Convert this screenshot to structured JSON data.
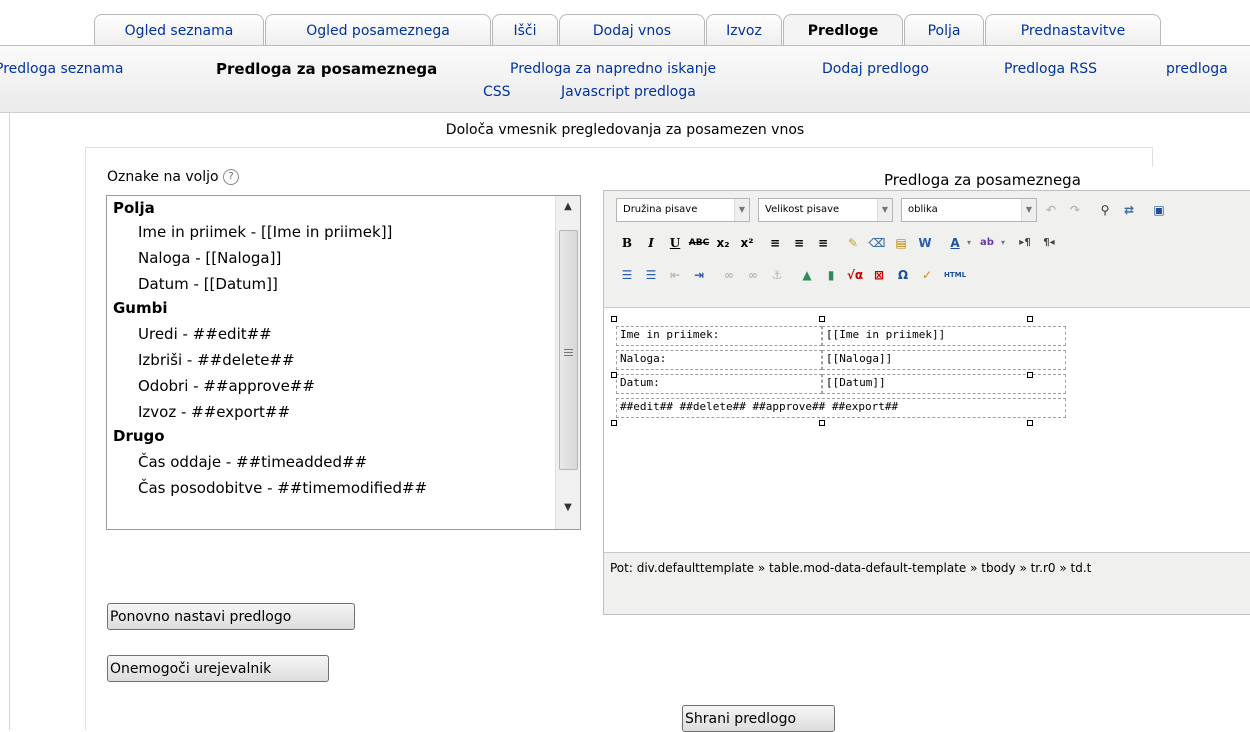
{
  "tabs": [
    {
      "label": "Ogled seznama"
    },
    {
      "label": "Ogled posameznega"
    },
    {
      "label": "Išči"
    },
    {
      "label": "Dodaj vnos"
    },
    {
      "label": "Izvoz"
    },
    {
      "label": "Predloge",
      "active": true
    },
    {
      "label": "Polja"
    },
    {
      "label": "Prednastavitve"
    }
  ],
  "subtabs": [
    {
      "label": "Predloga seznama"
    },
    {
      "label": "Predloga za posameznega",
      "active": true
    },
    {
      "label": "Predloga za napredno iskanje"
    },
    {
      "label": "Dodaj predlogo"
    },
    {
      "label": "Predloga RSS"
    },
    {
      "label": "predloga"
    },
    {
      "label": "CSS"
    },
    {
      "label": "Javascript predloga"
    }
  ],
  "description": "Določa vmesnik pregledovanja za posamezen vnos",
  "tags": {
    "label": "Oznake na voljo",
    "help_icon": "?",
    "items": [
      {
        "text": "Polja",
        "type": "group"
      },
      {
        "text": "Ime in priimek - [[Ime in priimek]]",
        "type": "item"
      },
      {
        "text": "Naloga - [[Naloga]]",
        "type": "item"
      },
      {
        "text": "Datum - [[Datum]]",
        "type": "item"
      },
      {
        "text": "Gumbi",
        "type": "group"
      },
      {
        "text": "Uredi - ##edit##",
        "type": "item"
      },
      {
        "text": "Izbriši - ##delete##",
        "type": "item"
      },
      {
        "text": "Odobri - ##approve##",
        "type": "item"
      },
      {
        "text": "Izvoz - ##export##",
        "type": "item"
      },
      {
        "text": "Drugo",
        "type": "group"
      },
      {
        "text": "Čas oddaje - ##timeadded##",
        "type": "item"
      },
      {
        "text": "Čas posodobitve - ##timemodified##",
        "type": "item"
      }
    ]
  },
  "buttons": {
    "reset": "Ponovno nastavi predlogo",
    "disable_editor": "Onemogoči urejevalnik",
    "save": "Shrani predlogo"
  },
  "editor": {
    "title": "Predloga za posameznega",
    "font_family": "Družina pisave",
    "font_size": "Velikost pisave",
    "format": "oblika",
    "toolbar_icons": {
      "row1": [
        "undo-icon",
        "redo-icon",
        "find-icon",
        "replace-icon",
        "fullscreen-icon"
      ],
      "row2": [
        "bold-icon",
        "italic-icon",
        "underline-icon",
        "strikethrough-icon",
        "subscript-icon",
        "superscript-icon",
        "align-left-icon",
        "align-center-icon",
        "align-right-icon",
        "cleanup-icon",
        "eraser-icon",
        "paste-text-icon",
        "paste-word-icon",
        "text-color-icon",
        "highlight-color-icon",
        "ltr-icon",
        "rtl-icon"
      ],
      "row3": [
        "unordered-list-icon",
        "ordered-list-icon",
        "outdent-icon",
        "indent-icon",
        "link-icon",
        "unlink-icon",
        "anchor-icon",
        "image-icon",
        "media-icon",
        "math-icon",
        "dragmath-icon",
        "special-char-icon",
        "spellcheck-icon",
        "html-icon"
      ]
    },
    "cells": {
      "label_name": "Ime in priimek:",
      "value_name": "[[Ime in priimek]]",
      "label_task": "Naloga:",
      "value_task": "[[Naloga]]",
      "label_date": "Datum:",
      "value_date": "[[Datum]]",
      "buttons": "##edit## ##delete## ##approve## ##export##"
    },
    "path": "Pot: div.defaulttemplate » table.mod-data-default-template » tbody » tr.r0 » td.t"
  }
}
